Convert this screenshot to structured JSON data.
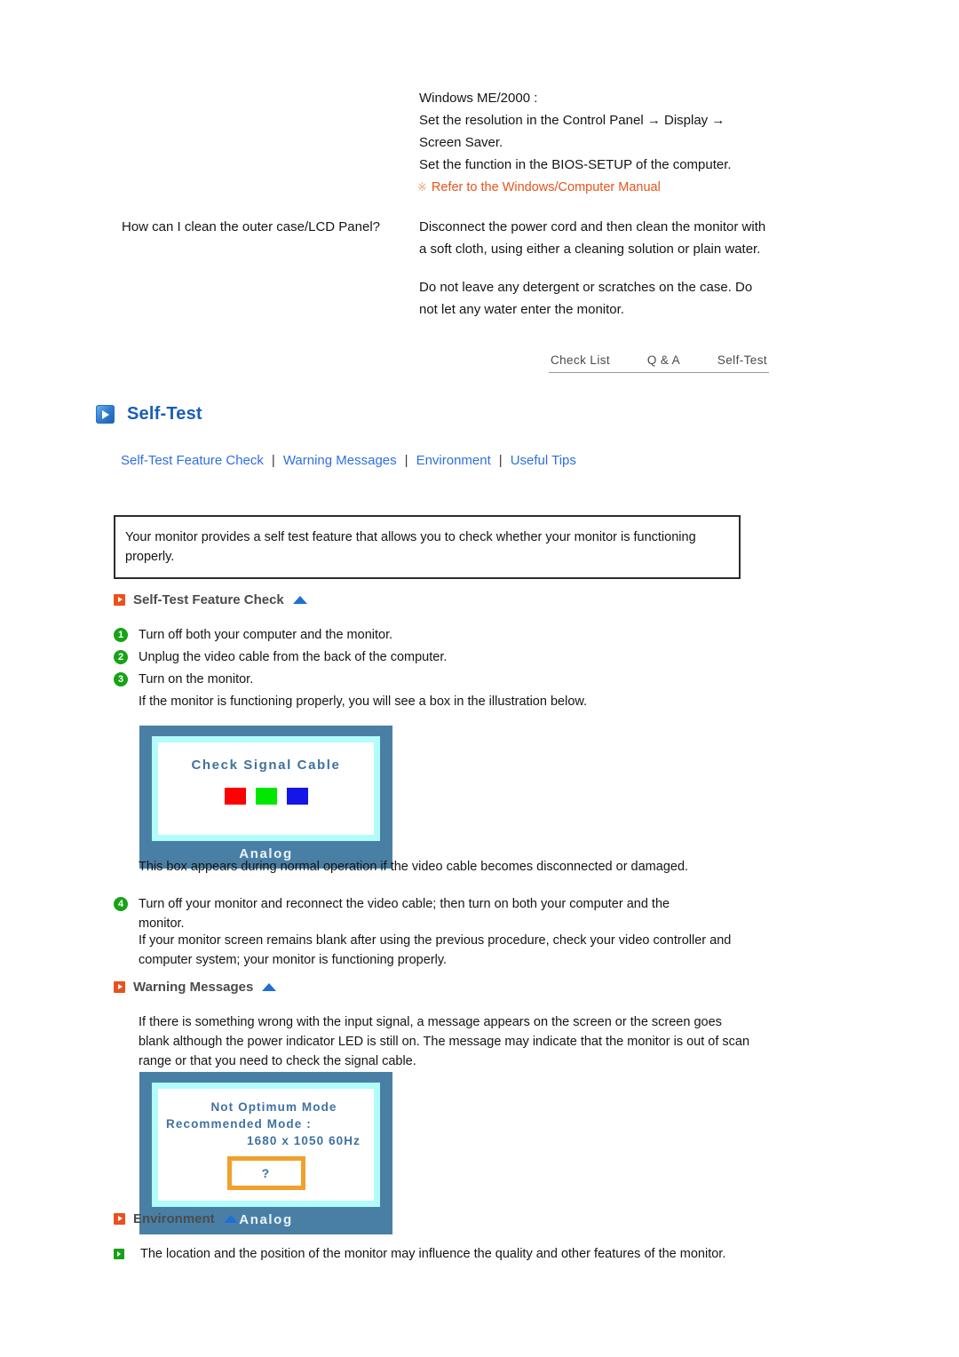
{
  "qa_continuation": {
    "answer_lines": [
      "Windows ME/2000 :",
      "Set the resolution in the Control Panel → Display →",
      "Screen Saver.",
      "Set the function in the BIOS-SETUP of the computer."
    ],
    "note_mark": "※",
    "note_text": "Refer to the Windows/Computer Manual",
    "question": "How can I clean the outer case/LCD Panel?",
    "answer_block_1": "Disconnect the power cord and then clean the monitor with a soft cloth, using either a cleaning solution or plain water.",
    "answer_block_2": "Do not leave any detergent or scratches on the case. Do not let any water enter the monitor."
  },
  "tabs": [
    {
      "label": "Check List"
    },
    {
      "label": "Q & A"
    },
    {
      "label": "Self-Test"
    }
  ],
  "page": {
    "title": "Self-Test",
    "title_icon": "blue-play-square-icon"
  },
  "subnav": {
    "separator": "|",
    "items": [
      {
        "label": "Self-Test Feature Check"
      },
      {
        "label": "Warning Messages"
      },
      {
        "label": "Environment"
      },
      {
        "label": "Useful Tips"
      }
    ]
  },
  "intro": {
    "text": "Your monitor provides a self test feature that allows you to check whether your monitor is functioning properly."
  },
  "sections": {
    "self_test_feature_check": {
      "heading": "Self-Test Feature Check",
      "steps": [
        {
          "num": "1",
          "text": "Turn off both your computer and the monitor."
        },
        {
          "num": "2",
          "text": "Unplug the video cable from the back of the computer."
        },
        {
          "num": "3",
          "text": "Turn on the monitor."
        }
      ],
      "after_step3": "If the monitor is functioning properly, you will see a box in the illustration below.",
      "after_illustration": "This box appears during normal operation if the video cable becomes disconnected or damaged.",
      "step4": {
        "num": "4",
        "text": "Turn off your monitor and reconnect the video cable; then turn on both your computer and the monitor."
      },
      "closing": "If your monitor screen remains blank after using the previous procedure, check your video controller and computer system; your monitor is functioning properly."
    },
    "warning_messages": {
      "heading": "Warning Messages",
      "body": "If there is something wrong with the input signal, a message appears on the screen or the screen goes blank although the power indicator LED is still on. The message may indicate that the monitor is out of scan range or that you need to check the signal cable."
    },
    "environment": {
      "heading": "Environment",
      "bullet": "The location and the position of the monitor may influence the quality and other features of the monitor."
    }
  },
  "illustrations": {
    "check_signal_cable": {
      "osd_title": "Check Signal Cable",
      "swatches": [
        "red",
        "green",
        "blue"
      ],
      "footer": "Analog"
    },
    "not_optimum_mode": {
      "line1": "Not Optimum Mode",
      "line2": "Recommended Mode :",
      "line3": "1680 x 1050   60Hz",
      "question_mark": "?",
      "footer": "Analog"
    }
  },
  "colors": {
    "link_blue": "#2e6fe0",
    "title_blue": "#1a5fb4",
    "orange_note": "#e8541c",
    "marker_orange": "#e8521e",
    "bullet_green": "#17a217",
    "monitor_frame": "#4a7fa5",
    "monitor_inner": "#b2fcfc",
    "osd_text": "#3f72a0",
    "qbox_orange": "#f0a12b"
  }
}
